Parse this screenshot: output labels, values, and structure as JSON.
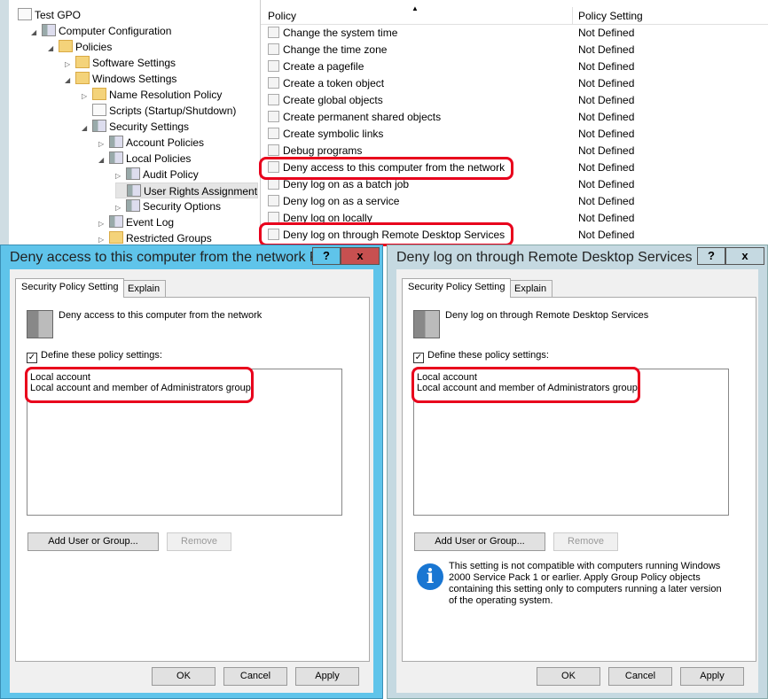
{
  "tree": [
    {
      "label": "Test GPO",
      "icon": "gpo-scroll-icon",
      "level": 0,
      "expander": ""
    },
    {
      "label": "Computer Configuration",
      "icon": "computer-icon",
      "level": 1,
      "expander": "◢"
    },
    {
      "label": "Policies",
      "icon": "folder-icon",
      "level": 2,
      "expander": "◢"
    },
    {
      "label": "Software Settings",
      "icon": "folder-icon",
      "level": 3,
      "expander": "▷"
    },
    {
      "label": "Windows Settings",
      "icon": "folder-icon",
      "level": 3,
      "expander": "◢"
    },
    {
      "label": "Name Resolution Policy",
      "icon": "folder-icon",
      "level": 4,
      "expander": "▷"
    },
    {
      "label": "Scripts (Startup/Shutdown)",
      "icon": "script-icon",
      "level": 4,
      "expander": ""
    },
    {
      "label": "Security Settings",
      "icon": "security-server-icon",
      "level": 4,
      "expander": "◢"
    },
    {
      "label": "Account Policies",
      "icon": "server-icon",
      "level": 5,
      "expander": "▷"
    },
    {
      "label": "Local Policies",
      "icon": "server-icon",
      "level": 5,
      "expander": "◢"
    },
    {
      "label": "Audit Policy",
      "icon": "server-icon",
      "level": 6,
      "expander": "▷"
    },
    {
      "label": "User Rights Assignment",
      "icon": "server-icon",
      "level": 6,
      "expander": "",
      "selected": true
    },
    {
      "label": "Security Options",
      "icon": "server-icon",
      "level": 6,
      "expander": "▷"
    },
    {
      "label": "Event Log",
      "icon": "server-icon",
      "level": 5,
      "expander": "▷"
    },
    {
      "label": "Restricted Groups",
      "icon": "folder-lock-icon",
      "level": 5,
      "expander": "▷"
    }
  ],
  "list": {
    "headers": {
      "policy": "Policy",
      "setting": "Policy Setting",
      "sort_indicator": "▲"
    },
    "rows": [
      {
        "policy": "Change the system time",
        "setting": "Not Defined"
      },
      {
        "policy": "Change the time zone",
        "setting": "Not Defined"
      },
      {
        "policy": "Create a pagefile",
        "setting": "Not Defined"
      },
      {
        "policy": "Create a token object",
        "setting": "Not Defined"
      },
      {
        "policy": "Create global objects",
        "setting": "Not Defined"
      },
      {
        "policy": "Create permanent shared objects",
        "setting": "Not Defined"
      },
      {
        "policy": "Create symbolic links",
        "setting": "Not Defined"
      },
      {
        "policy": "Debug programs",
        "setting": "Not Defined"
      },
      {
        "policy": "Deny access to this computer from the network",
        "setting": "Not Defined"
      },
      {
        "policy": "Deny log on as a batch job",
        "setting": "Not Defined"
      },
      {
        "policy": "Deny log on as a service",
        "setting": "Not Defined"
      },
      {
        "policy": "Deny log on locally",
        "setting": "Not Defined"
      },
      {
        "policy": "Deny log on through Remote Desktop Services",
        "setting": "Not Defined"
      }
    ]
  },
  "dialog_left": {
    "title": "Deny access to this computer from the network Pr...",
    "help": "?",
    "close": "x",
    "tabs": [
      "Security Policy Setting",
      "Explain"
    ],
    "policy_name": "Deny access to this computer from the network",
    "checkbox_label": "Define these policy settings:",
    "checked": true,
    "accounts": [
      "Local account",
      "Local account and member of Administrators group"
    ],
    "add": "Add User or Group...",
    "remove": "Remove",
    "ok": "OK",
    "cancel": "Cancel",
    "apply": "Apply",
    "frame_color": "#5fc4ea"
  },
  "dialog_right": {
    "title": "Deny log on through Remote Desktop Services Pr...",
    "help": "?",
    "close": "x",
    "tabs": [
      "Security Policy Setting",
      "Explain"
    ],
    "policy_name": "Deny log on through Remote Desktop Services",
    "checkbox_label": "Define these policy settings:",
    "checked": true,
    "accounts": [
      "Local account",
      "Local account and member of Administrators group"
    ],
    "add": "Add User or Group...",
    "remove": "Remove",
    "info": "This setting is not compatible with computers running Windows 2000 Service Pack 1 or earlier.  Apply Group Policy objects containing this setting only to computers running a later version of the operating system.",
    "ok": "OK",
    "cancel": "Cancel",
    "apply": "Apply",
    "frame_color": "#c5d9e1"
  },
  "highlight_color": "#e8001c"
}
